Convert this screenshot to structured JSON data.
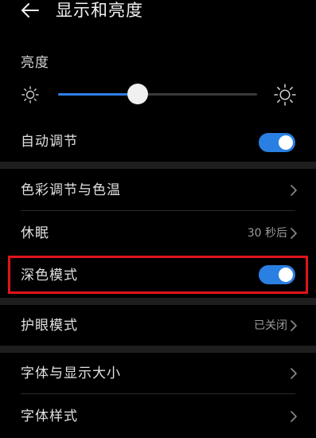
{
  "header": {
    "title": "显示和亮度",
    "back_icon": "back-arrow-icon"
  },
  "brightness": {
    "label": "亮度",
    "level": 0.4,
    "min_icon": "sun-small-icon",
    "max_icon": "sun-large-icon"
  },
  "settings": {
    "auto_adjust": {
      "label": "自动调节",
      "enabled": true
    },
    "color_temp": {
      "label": "色彩调节与色温"
    },
    "sleep": {
      "label": "休眠",
      "value": "30 秒后"
    },
    "dark_mode": {
      "label": "深色模式",
      "enabled": true
    },
    "eye_care": {
      "label": "护眼模式",
      "value": "已关闭"
    },
    "font_display_size": {
      "label": "字体与显示大小"
    },
    "font_style": {
      "label": "字体样式"
    }
  },
  "colors": {
    "accent": "#2a7fe3",
    "highlight": "#e0141b",
    "background": "#000000"
  }
}
